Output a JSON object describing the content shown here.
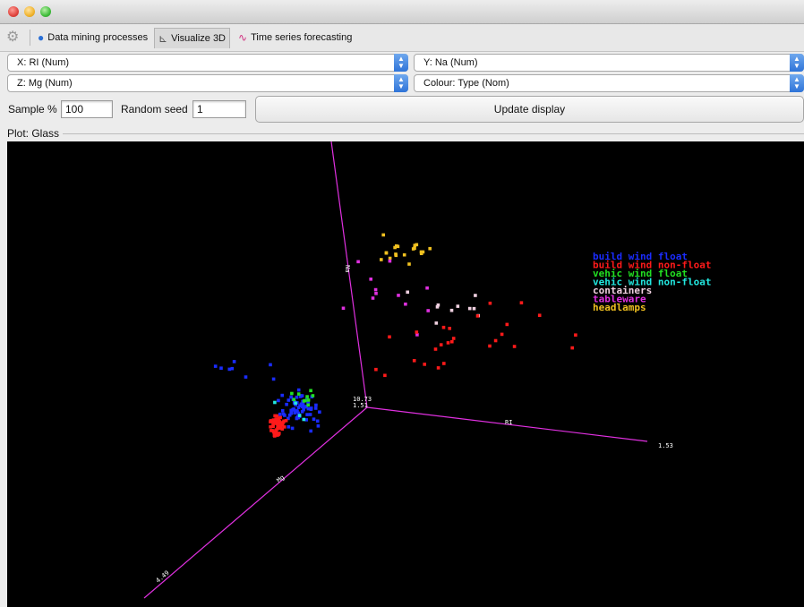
{
  "window": {
    "buttons": [
      "close",
      "minimize",
      "zoom"
    ]
  },
  "tabs": [
    {
      "label": "Data mining processes",
      "icon": "globe-icon",
      "active": false
    },
    {
      "label": "Visualize 3D",
      "icon": "chart-3d-icon",
      "active": true
    },
    {
      "label": "Time series forecasting",
      "icon": "line-chart-icon",
      "active": false
    }
  ],
  "selectors": {
    "x": "X: RI (Num)",
    "y": "Y: Na (Num)",
    "z": "Z: Mg (Num)",
    "colour": "Colour: Type (Nom)"
  },
  "sample": {
    "label": "Sample %",
    "value": "100"
  },
  "seed": {
    "label": "Random seed",
    "value": "1"
  },
  "update_button": "Update display",
  "plot": {
    "label": "Plot: Glass",
    "axis_labels": {
      "x_axis": "RI",
      "x_tick": "1.53",
      "y_axis": "Na",
      "y_tick_a": "10.73",
      "y_tick_b": "1.51",
      "z_axis": "Mg",
      "z_tick": "4.49"
    },
    "legend": [
      {
        "label": "build wind float",
        "color": "#1a2cff"
      },
      {
        "label": "build wind non-float",
        "color": "#ff1a1a"
      },
      {
        "label": "vehic wind float",
        "color": "#22e022"
      },
      {
        "label": "vehic wind non-float",
        "color": "#22e8e0"
      },
      {
        "label": "containers",
        "color": "#f0d0e0"
      },
      {
        "label": "tableware",
        "color": "#e030e0"
      },
      {
        "label": "headlamps",
        "color": "#f0c020"
      }
    ],
    "colors": {
      "background": "#000000",
      "axis": "#e030e0"
    }
  }
}
